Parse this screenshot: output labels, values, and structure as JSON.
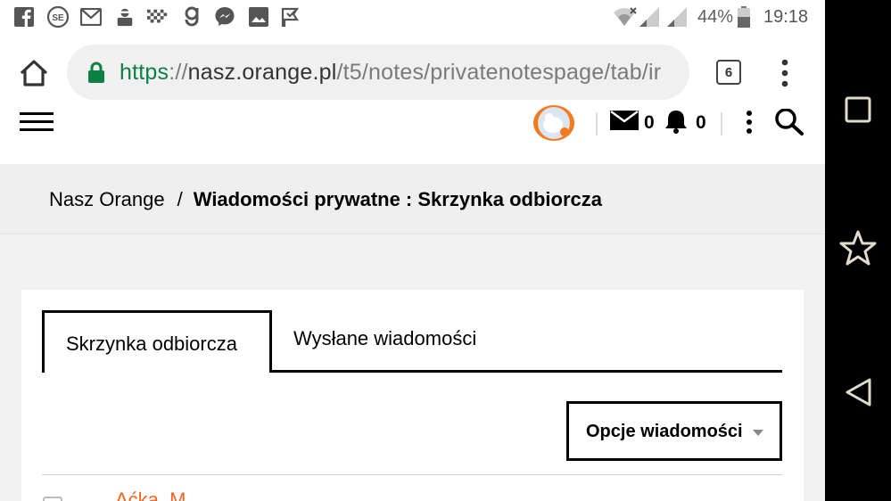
{
  "status_bar": {
    "battery": "44%",
    "time": "19:18",
    "notification_icons": [
      "facebook-icon",
      "se-icon",
      "gmail-icon",
      "thief-icon",
      "checker-icon",
      "g-icon",
      "messenger-icon",
      "photo-icon",
      "flag-icon"
    ]
  },
  "browser": {
    "url_scheme": "https",
    "url_sep": "://",
    "url_host": "nasz.orange.pl",
    "url_path": "/t5/notes/privatenotespage/tab/ir",
    "tab_count": "6"
  },
  "header": {
    "messages_count": "0",
    "notifications_count": "0"
  },
  "breadcrumb": {
    "home": "Nasz Orange",
    "separator": "/",
    "current": "Wiadomości prywatne : Skrzynka odbiorcza"
  },
  "tabs": {
    "inbox": "Skrzynka odbiorcza",
    "sent": "Wysłane wiadomości"
  },
  "options_button": "Opcje wiadomości",
  "message_row": {
    "sender": "Aćka_M"
  },
  "colors": {
    "accent": "#f26522",
    "url_secure": "#0b8043"
  }
}
